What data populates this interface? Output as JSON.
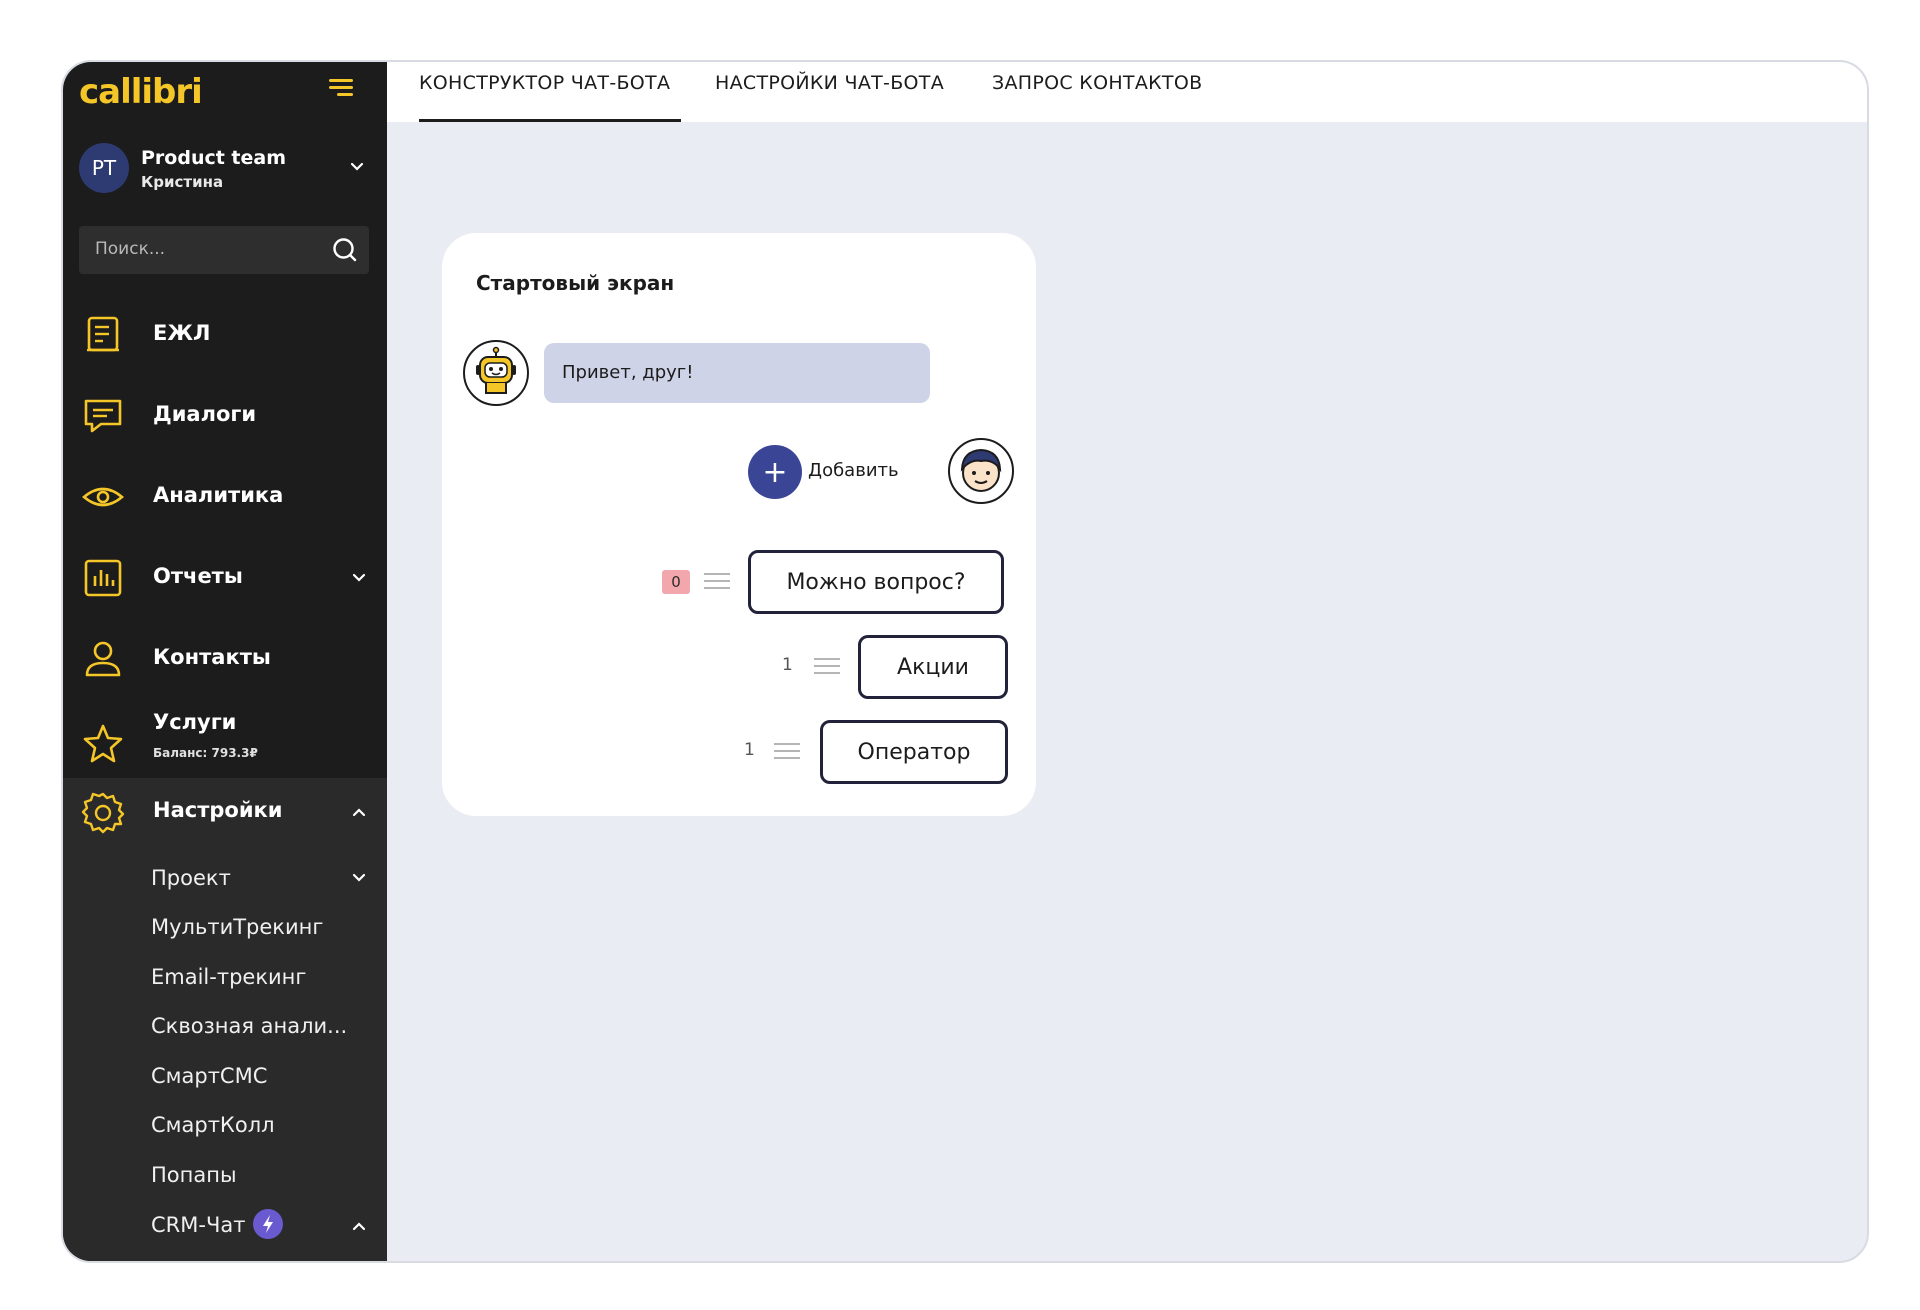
{
  "brand": {
    "logo_text": "callibri",
    "accent": "#f5c628"
  },
  "account": {
    "initials": "PT",
    "name": "Product team",
    "user": "Кристина"
  },
  "search": {
    "placeholder": "Поиск..."
  },
  "nav": {
    "ezhl": "ЕЖЛ",
    "dialogs": "Диалоги",
    "analytics": "Аналитика",
    "reports": "Отчеты",
    "contacts": "Контакты",
    "services": "Услуги",
    "services_balance": "Баланс: 793.3₽",
    "settings": "Настройки"
  },
  "settings_items": [
    "Проект",
    "МультиТрекинг",
    "Email-трекинг",
    "Сквозная анали...",
    "СмартСМС",
    "СмартКолл",
    "Попапы",
    "CRM-Чат"
  ],
  "tabs": [
    "КОНСТРУКТОР ЧАТ-БОТА",
    "НАСТРОЙКИ ЧАТ-БОТА",
    "ЗАПРОС КОНТАКТОВ"
  ],
  "card": {
    "title": "Стартовый экран",
    "bot_message": "Привет, друг!",
    "add_label": "Добавить",
    "options": [
      {
        "label": "Можно вопрос?",
        "count": "0"
      },
      {
        "label": "Акции",
        "count": "1"
      },
      {
        "label": "Оператор",
        "count": "1"
      }
    ]
  }
}
